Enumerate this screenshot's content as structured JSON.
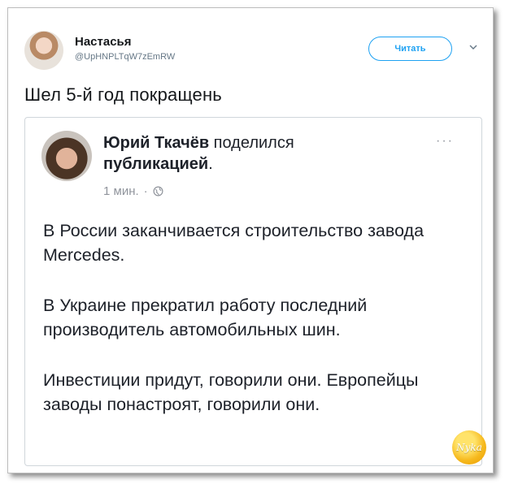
{
  "tweet": {
    "author_name": "Настасья",
    "author_handle": "@UpHNPLTqW7zEmRW",
    "follow_label": "Читать",
    "text": "Шел 5-й год покращень"
  },
  "embedded_post": {
    "author": "Юрий Ткачёв",
    "action": "поделился",
    "action_object": "публикацией",
    "period": ".",
    "time": "1 мин.",
    "separator": "·",
    "more": "···",
    "paragraphs": [
      "В России заканчивается строительство завода Mercedes.",
      "В Украине прекратил работу последний производитель автомобильных шин.",
      "Инвестиции придут, говорили они. Европейцы заводы понастроят, говорили они."
    ]
  },
  "watermark": {
    "text": "Nyka"
  },
  "colors": {
    "accent": "#1da1f2",
    "meta": "#90949c"
  }
}
